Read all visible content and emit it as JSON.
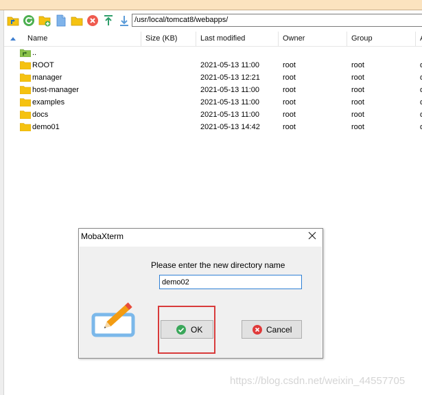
{
  "toolbar": {
    "buttons": [
      {
        "name": "parent-directory-icon"
      },
      {
        "name": "refresh-icon"
      },
      {
        "name": "new-folder-icon"
      },
      {
        "name": "new-file-icon"
      },
      {
        "name": "open-folder-icon"
      },
      {
        "name": "delete-icon"
      },
      {
        "name": "upload-icon"
      },
      {
        "name": "download-icon"
      }
    ],
    "path": "/usr/local/tomcat8/webapps/"
  },
  "columns": {
    "name": "Name",
    "size": "Size (KB)",
    "modified": "Last modified",
    "owner": "Owner",
    "group": "Group",
    "extra": "A"
  },
  "files": [
    {
      "name": "..",
      "size": "",
      "modified": "",
      "owner": "",
      "group": "",
      "extra": "",
      "icon": "parent-folder-icon"
    },
    {
      "name": "ROOT",
      "size": "",
      "modified": "2021-05-13 11:00",
      "owner": "root",
      "group": "root",
      "extra": "d",
      "icon": "folder-icon"
    },
    {
      "name": "manager",
      "size": "",
      "modified": "2021-05-13 12:21",
      "owner": "root",
      "group": "root",
      "extra": "d",
      "icon": "folder-icon"
    },
    {
      "name": "host-manager",
      "size": "",
      "modified": "2021-05-13 11:00",
      "owner": "root",
      "group": "root",
      "extra": "d",
      "icon": "folder-icon"
    },
    {
      "name": "examples",
      "size": "",
      "modified": "2021-05-13 11:00",
      "owner": "root",
      "group": "root",
      "extra": "d",
      "icon": "folder-icon"
    },
    {
      "name": "docs",
      "size": "",
      "modified": "2021-05-13 11:00",
      "owner": "root",
      "group": "root",
      "extra": "d",
      "icon": "folder-icon"
    },
    {
      "name": "demo01",
      "size": "",
      "modified": "2021-05-13 14:42",
      "owner": "root",
      "group": "root",
      "extra": "d",
      "icon": "folder-icon"
    }
  ],
  "dialog": {
    "title": "MobaXterm",
    "prompt": "Please enter the new directory name",
    "input_value": "demo02",
    "ok_label": "OK",
    "cancel_label": "Cancel"
  },
  "watermark": "https://blog.csdn.net/weixin_44557705",
  "colors": {
    "folder": "#f5c211",
    "accent": "#2d7fd4",
    "highlight": "#d83a3a",
    "ok_icon": "#3aa75a",
    "cancel_icon": "#e03a3a"
  }
}
